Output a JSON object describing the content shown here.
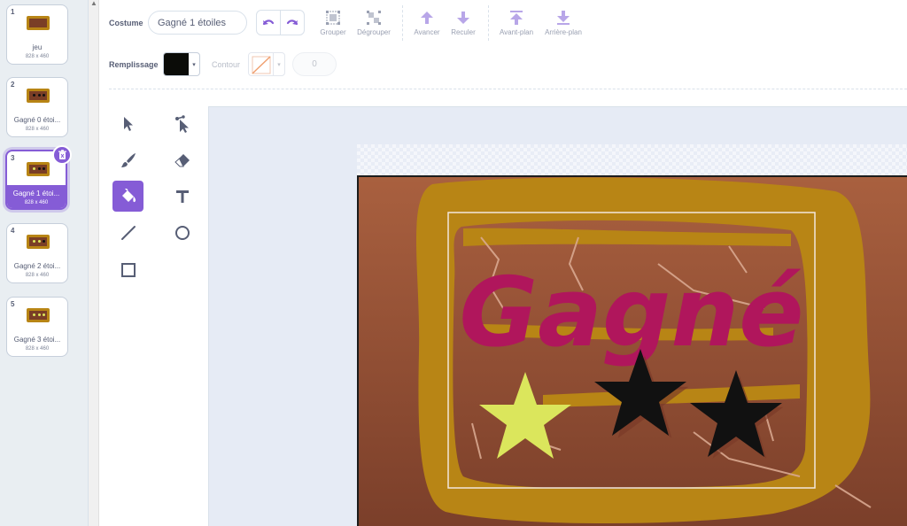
{
  "costumes": [
    {
      "number": "1",
      "name": "jeu",
      "size": "828 x 460",
      "stars": 0
    },
    {
      "number": "2",
      "name": "Gagné 0 étoi...",
      "size": "828 x 460",
      "stars": 3
    },
    {
      "number": "3",
      "name": "Gagné 1 étoi...",
      "size": "828 x 460",
      "stars": 3
    },
    {
      "number": "4",
      "name": "Gagné 2 étoi...",
      "size": "828 x 460",
      "stars": 3
    },
    {
      "number": "5",
      "name": "Gagné 3 étoi...",
      "size": "828 x 460",
      "stars": 3
    }
  ],
  "selected_costume": "3",
  "toolbar": {
    "costume_label": "Costume",
    "costume_name": "Gagné 1 étoiles",
    "group": "Grouper",
    "ungroup": "Dégrouper",
    "forward": "Avancer",
    "backward": "Reculer",
    "front": "Avant-plan",
    "back": "Arrière-plan",
    "fill_label": "Remplissage",
    "outline_label": "Contour",
    "outline_width": "0"
  },
  "colors": {
    "accent": "#855cd6",
    "fill": "#0b0c08",
    "background_top": "#a9603f",
    "background_bottom": "#7b3f2a",
    "frame": "#b88515",
    "title_text": "#b0165c",
    "star_yellow": "#dbe65c",
    "star_black": "#111111"
  },
  "artwork": {
    "title": "Gagné"
  },
  "tools": [
    {
      "name": "select",
      "icon": "arrow-select-icon"
    },
    {
      "name": "reshape",
      "icon": "reshape-icon"
    },
    {
      "name": "brush",
      "icon": "brush-icon"
    },
    {
      "name": "eraser",
      "icon": "eraser-icon"
    },
    {
      "name": "fill",
      "icon": "fill-bucket-icon",
      "active": true
    },
    {
      "name": "text",
      "icon": "text-icon"
    },
    {
      "name": "line",
      "icon": "line-icon"
    },
    {
      "name": "circle",
      "icon": "circle-icon"
    },
    {
      "name": "rectangle",
      "icon": "rectangle-icon"
    }
  ]
}
